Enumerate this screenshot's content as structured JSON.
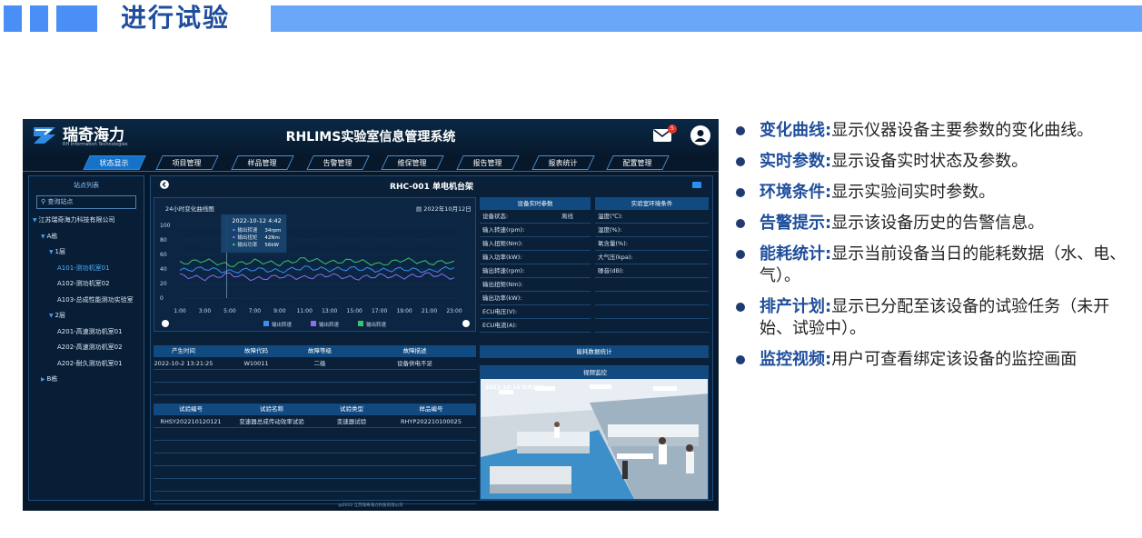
{
  "slide": {
    "title": "进行试验"
  },
  "app": {
    "logo_name": "瑞奇海力",
    "logo_sub": "RH Information Technologies",
    "system_title": "RHLIMS实验室信息管理系统",
    "mail_badge": "5",
    "footer": "@2022 江苏瑞奇海力科技有限公司"
  },
  "nav": {
    "tabs": [
      {
        "label": "状态显示",
        "active": true
      },
      {
        "label": "项目管理"
      },
      {
        "label": "样品管理"
      },
      {
        "label": "告警管理"
      },
      {
        "label": "维保管理"
      },
      {
        "label": "报告管理"
      },
      {
        "label": "报表统计"
      },
      {
        "label": "配置管理"
      }
    ]
  },
  "sidebar": {
    "title": "站点列表",
    "search_placeholder": "查询站点",
    "items": [
      {
        "label": "江苏瑞奇海力科技有限公司",
        "level": 0,
        "arrow": true
      },
      {
        "label": "A栋",
        "level": 1,
        "arrow": true
      },
      {
        "label": "1层",
        "level": 2,
        "arrow": true
      },
      {
        "label": "A101-测功机室01",
        "level": 3,
        "selected": true
      },
      {
        "label": "A102-测功机室02",
        "level": 3
      },
      {
        "label": "A103-总成性能测功实验室",
        "level": 3
      },
      {
        "label": "2层",
        "level": 2,
        "arrow": true
      },
      {
        "label": "A201-高速测功机室01",
        "level": 3
      },
      {
        "label": "A202-高速测功机室02",
        "level": 3
      },
      {
        "label": "A202-耐久测功机室01",
        "level": 3
      },
      {
        "label": "B栋",
        "level": 1,
        "arrow": true,
        "collapsed": true
      }
    ]
  },
  "main": {
    "title": "RHC-001 单电机台架"
  },
  "chart": {
    "title": "24小时变化曲线图",
    "date": "2022年10月12日",
    "tooltip": {
      "time": "2022-10-12 4:42",
      "rows": [
        {
          "name": "输出转速",
          "value": "34rpm"
        },
        {
          "name": "输出扭矩",
          "value": "42Nm"
        },
        {
          "name": "输出功率",
          "value": "56kW"
        }
      ]
    },
    "colors": {
      "speed": "#3b8ff0",
      "torque": "#8a6ff0",
      "power": "#38c46a"
    }
  },
  "chart_data": {
    "type": "line",
    "x": [
      "1:00",
      "3:00",
      "5:00",
      "7:00",
      "9:00",
      "11:00",
      "13:00",
      "15:00",
      "17:00",
      "19:00",
      "21:00",
      "23:00"
    ],
    "ylim": [
      0,
      100
    ],
    "yticks": [
      0,
      20,
      40,
      60,
      80,
      100
    ],
    "series": [
      {
        "name": "输出转速",
        "values": [
          38,
          41,
          36,
          40,
          37,
          42,
          39,
          41,
          38,
          40,
          37,
          42
        ]
      },
      {
        "name": "输出转速",
        "values": [
          31,
          27,
          33,
          26,
          30,
          28,
          32,
          27,
          31,
          29,
          33,
          28
        ]
      },
      {
        "name": "输出转速",
        "values": [
          48,
          52,
          45,
          51,
          47,
          54,
          49,
          52,
          46,
          53,
          48,
          51
        ]
      }
    ]
  },
  "device_params": {
    "header": "设备实时参数",
    "rows": [
      {
        "label": "设备状态:",
        "value": "离线"
      },
      {
        "label": "输入转速(rpm):",
        "value": ""
      },
      {
        "label": "输入扭矩(Nm):",
        "value": ""
      },
      {
        "label": "输入功率(kW):",
        "value": ""
      },
      {
        "label": "输出转速(rpm):",
        "value": ""
      },
      {
        "label": "输出扭矩(Nm):",
        "value": ""
      },
      {
        "label": "输出功率(kW):",
        "value": ""
      },
      {
        "label": "ECU电压(V):",
        "value": ""
      },
      {
        "label": "ECU电流(A):",
        "value": ""
      }
    ]
  },
  "env_params": {
    "header": "实验室环境条件",
    "rows": [
      {
        "label": "温度(℃):"
      },
      {
        "label": "湿度(%):"
      },
      {
        "label": "氧含量(%):"
      },
      {
        "label": "大气压(kpa):"
      },
      {
        "label": "噪音(dB):"
      }
    ]
  },
  "alarm_table": {
    "columns": [
      "产生时间",
      "故障代码",
      "故障等级",
      "故障描述"
    ],
    "rows": [
      [
        "2022-10-2 13:21:25",
        "W10011",
        "二级",
        "设备供电不足"
      ]
    ]
  },
  "energy": {
    "header": "能耗数据统计"
  },
  "video": {
    "header": "视频监控",
    "timestamp": "2022-10-16 9:02:05"
  },
  "test_table": {
    "columns": [
      "试验编号",
      "试验名称",
      "试验类型",
      "样品编号"
    ],
    "rows": [
      [
        "RHSY202210120121",
        "变速器总成传动效率试验",
        "变速器试验",
        "RHYP202210100025"
      ]
    ]
  },
  "bullets": [
    {
      "keyword": "变化曲线:",
      "text": "显示仪器设备主要参数的变化曲线。"
    },
    {
      "keyword": "实时参数:",
      "text": "显示设备实时状态及参数。"
    },
    {
      "keyword": "环境条件:",
      "text": "显示实验间实时参数。"
    },
    {
      "keyword": "告警提示:",
      "text": "显示该设备历史的告警信息。"
    },
    {
      "keyword": "能耗统计:",
      "text": "显示当前设备当日的能耗数据（水、电、气）。"
    },
    {
      "keyword": "排产计划:",
      "text": "显示已分配至该设备的试验任务（未开始、试验中）。"
    },
    {
      "keyword": "监控视频:",
      "text": "用户可查看绑定该设备的监控画面"
    }
  ]
}
